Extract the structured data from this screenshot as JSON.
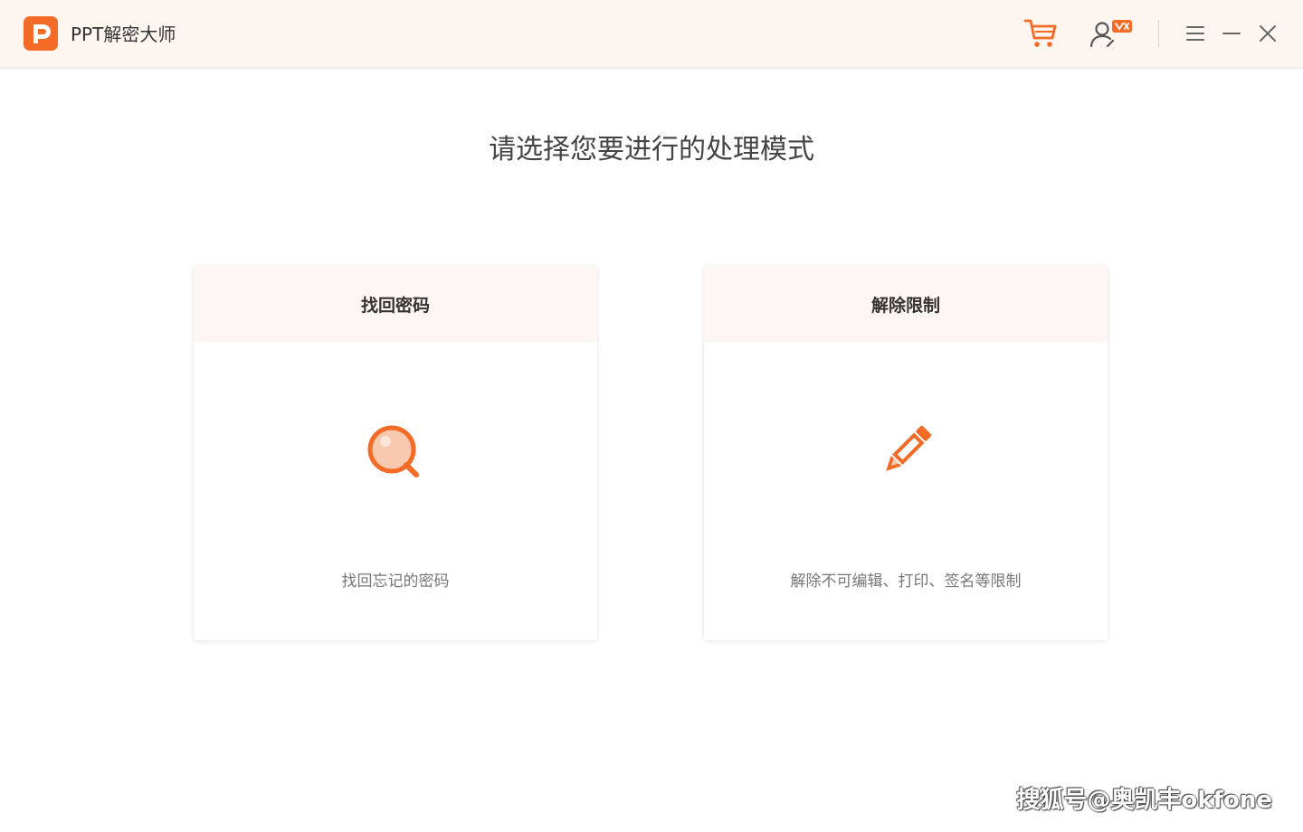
{
  "app": {
    "title": "PPT解密大师"
  },
  "titlebar": {
    "icons": [
      "cart-icon",
      "user-icon",
      "menu-icon",
      "minimize-icon",
      "close-icon"
    ]
  },
  "main": {
    "heading": "请选择您要进行的处理模式",
    "cards": [
      {
        "title": "找回密码",
        "icon": "search-icon",
        "description": "找回忘记的密码"
      },
      {
        "title": "解除限制",
        "icon": "pencil-icon",
        "description": "解除不可编辑、打印、签名等限制"
      }
    ]
  },
  "watermark": "搜狐号@奥凯丰okfone",
  "colors": {
    "accent": "#f36b27",
    "accent_light": "#f8c9ae",
    "titlebar_bg": "#fdf5f0",
    "card_head_bg": "#fdf6f2"
  }
}
